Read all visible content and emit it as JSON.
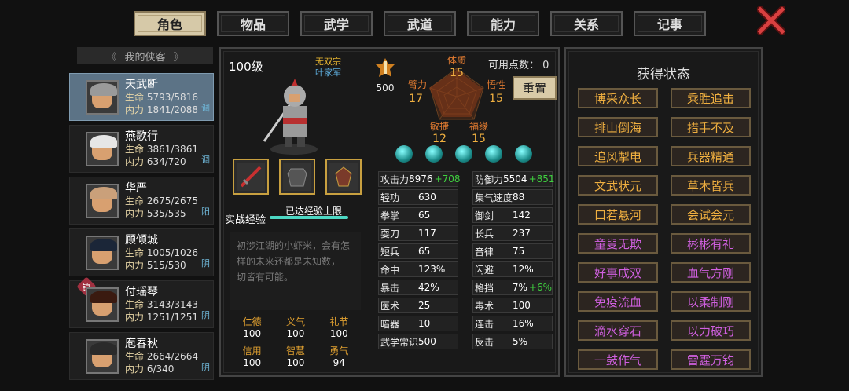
{
  "tabs": [
    "角色",
    "物品",
    "武学",
    "武道",
    "能力",
    "关系",
    "记事"
  ],
  "list_header": "我的侠客",
  "characters": [
    {
      "name": "天武断",
      "hp_label": "生命",
      "hp": "5793/5816",
      "mp_label": "内力",
      "mp": "1841/2088",
      "tag": "调",
      "hair": "#9a9a9a"
    },
    {
      "name": "燕歌行",
      "hp_label": "生命",
      "hp": "3861/3861",
      "mp_label": "内力",
      "mp": "634/720",
      "tag": "调",
      "hair": "#e6e6e6"
    },
    {
      "name": "华严",
      "hp_label": "生命",
      "hp": "2675/2675",
      "mp_label": "内力",
      "mp": "535/535",
      "tag": "阳",
      "hair": "#caa07a"
    },
    {
      "name": "顾倾城",
      "hp_label": "生命",
      "hp": "1005/1026",
      "mp_label": "内力",
      "mp": "515/530",
      "tag": "阴",
      "hair": "#1b2638"
    },
    {
      "name": "付瑶琴",
      "hp_label": "生命",
      "hp": "3143/3143",
      "mp_label": "内力",
      "mp": "1251/1251",
      "tag": "阴",
      "hair": "#3a1a10",
      "badge": "锦"
    },
    {
      "name": "庖春秋",
      "hp_label": "生命",
      "hp": "2664/2664",
      "mp_label": "内力",
      "mp": "6/340",
      "tag": "阴",
      "hair": "#2a2a2a"
    }
  ],
  "profile": {
    "level": "100级",
    "sect": "无双宗",
    "title": "叶家军",
    "medal_value": "500",
    "points_label": "可用点数：",
    "points": "0",
    "reset": "重置"
  },
  "attributes": {
    "tizhi": {
      "label": "体质",
      "value": "15"
    },
    "bili": {
      "label": "臂力",
      "value": "17"
    },
    "wuxing": {
      "label": "悟性",
      "value": "15"
    },
    "minjie": {
      "label": "敏捷",
      "value": "12"
    },
    "fuyuan": {
      "label": "福缘",
      "value": "15"
    }
  },
  "experience": {
    "label": "实战经验",
    "status": "已达经验上限",
    "fill": 1.0
  },
  "description": "初涉江湖的小虾米，会有怎样的未来还都是未知数，一切皆有可能。",
  "virtues": [
    {
      "label": "仁德",
      "value": "100"
    },
    {
      "label": "义气",
      "value": "100"
    },
    {
      "label": "礼节",
      "value": "100"
    },
    {
      "label": "信用",
      "value": "100"
    },
    {
      "label": "智慧",
      "value": "100"
    },
    {
      "label": "勇气",
      "value": "94"
    }
  ],
  "stats": [
    {
      "label": "攻击力",
      "value": "8976",
      "bonus": "+708"
    },
    {
      "label": "防御力",
      "value": "5504",
      "bonus": "+851"
    },
    {
      "label": "轻功",
      "value": "630"
    },
    {
      "label": "集气速度",
      "value": "88"
    },
    {
      "label": "拳掌",
      "value": "65"
    },
    {
      "label": "御剑",
      "value": "142"
    },
    {
      "label": "耍刀",
      "value": "117"
    },
    {
      "label": "长兵",
      "value": "237"
    },
    {
      "label": "短兵",
      "value": "65"
    },
    {
      "label": "音律",
      "value": "75"
    },
    {
      "label": "命中",
      "value": "123%"
    },
    {
      "label": "闪避",
      "value": "12%"
    },
    {
      "label": "暴击",
      "value": "42%"
    },
    {
      "label": "格挡",
      "value": "7%",
      "bonus": "+6%"
    },
    {
      "label": "医术",
      "value": "25"
    },
    {
      "label": "毒术",
      "value": "100"
    },
    {
      "label": "暗器",
      "value": "10"
    },
    {
      "label": "连击",
      "value": "16%"
    },
    {
      "label": "武学常识",
      "value": "500"
    },
    {
      "label": "反击",
      "value": "5%"
    }
  ],
  "status_title": "获得状态",
  "buffs": [
    {
      "label": "博采众长",
      "color": "gold"
    },
    {
      "label": "乘胜追击",
      "color": "gold"
    },
    {
      "label": "排山倒海",
      "color": "gold"
    },
    {
      "label": "措手不及",
      "color": "gold"
    },
    {
      "label": "追风掣电",
      "color": "gold"
    },
    {
      "label": "兵器精通",
      "color": "gold"
    },
    {
      "label": "文武状元",
      "color": "gold"
    },
    {
      "label": "草木皆兵",
      "color": "gold"
    },
    {
      "label": "口若悬河",
      "color": "gold"
    },
    {
      "label": "会试会元",
      "color": "gold"
    },
    {
      "label": "童叟无欺",
      "color": "purple"
    },
    {
      "label": "彬彬有礼",
      "color": "purple"
    },
    {
      "label": "好事成双",
      "color": "purple"
    },
    {
      "label": "血气方刚",
      "color": "purple"
    },
    {
      "label": "免疫流血",
      "color": "purple"
    },
    {
      "label": "以柔制刚",
      "color": "purple"
    },
    {
      "label": "滴水穿石",
      "color": "purple"
    },
    {
      "label": "以力破巧",
      "color": "purple"
    },
    {
      "label": "一鼓作气",
      "color": "purple"
    },
    {
      "label": "雷霆万钧",
      "color": "purple"
    }
  ],
  "colors": {
    "gold": "#f0b040",
    "purple": "#d060e0",
    "active_tab": "#d6c9a8",
    "active_char": "#5c7386"
  }
}
